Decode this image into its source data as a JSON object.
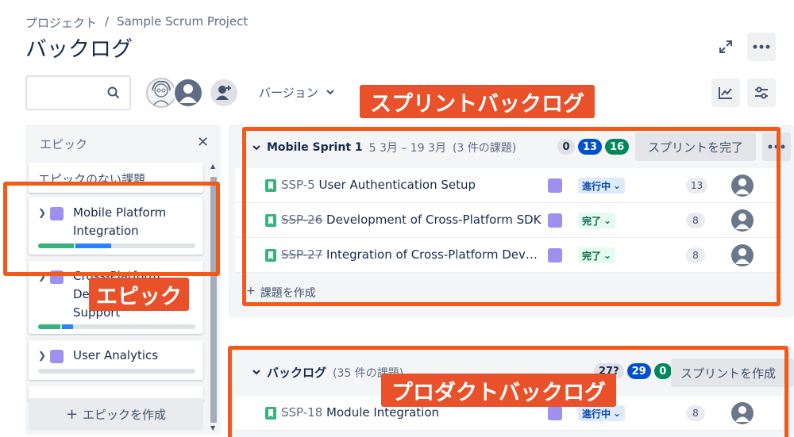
{
  "breadcrumb": {
    "project_label": "プロジェクト",
    "sep": "/",
    "project_name": "Sample Scrum Project"
  },
  "page_title": "バックログ",
  "toolbar": {
    "version_label": "バージョン"
  },
  "epic_panel": {
    "title": "エピック",
    "close": "✕",
    "no_epic": "エピックのない課題",
    "items": [
      {
        "name_line1": "Mobile Platform",
        "name_line2": "Integration"
      },
      {
        "name_line1": "Cross-Platform",
        "name_line2": "Development",
        "name_line3": "Support"
      },
      {
        "name_line1": "User Analytics"
      }
    ],
    "create_label": "エピックを作成"
  },
  "sprint": {
    "name": "Mobile Sprint 1",
    "dates": "5 3月 – 19 3月",
    "count": "(3 件の課題)",
    "counts": {
      "todo": "0",
      "in_progress": "13",
      "done": "16"
    },
    "complete_label": "スプリントを完了",
    "issues": [
      {
        "key": "SSP-5",
        "summary": "User Authentication Setup",
        "status": "進行中",
        "points": "13"
      },
      {
        "key": "SSP-26",
        "summary": "Development of Cross-Platform SDK",
        "status": "完了",
        "points": "8"
      },
      {
        "key": "SSP-27",
        "summary": "Integration of Cross-Platform Develo…",
        "status": "完了",
        "points": "8"
      }
    ],
    "create_issue": "課題を作成"
  },
  "backlog": {
    "name": "バックログ",
    "count": "(35 件の課題)",
    "counts": {
      "todo": "27?",
      "in_progress": "29",
      "done": "0"
    },
    "start_label": "スプリントを作成",
    "issues": [
      {
        "key": "SSP-18",
        "summary": "Module Integration",
        "status": "進行中",
        "points": "8"
      }
    ]
  },
  "annotations": {
    "sprint_backlog": "スプリントバックログ",
    "epic": "エピック",
    "product_backlog": "プロダクトバックログ"
  },
  "colors": {
    "accent": "#e8512a",
    "outline": "#f25a1c",
    "epic": "#9f8fef",
    "blue": "#0052cc",
    "green": "#00875a"
  }
}
